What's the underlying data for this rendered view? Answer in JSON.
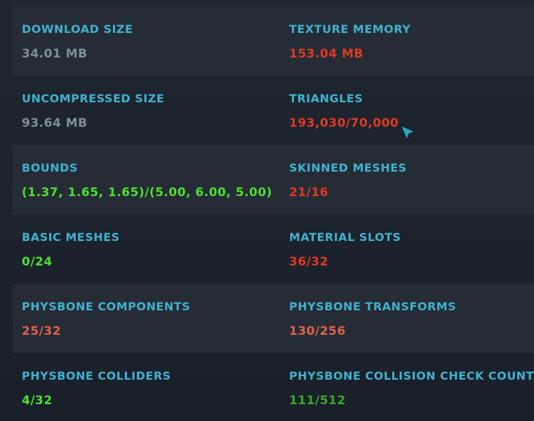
{
  "colors": {
    "label": "#3fb2cf",
    "neutral": "#7d8f99",
    "bad": "#df3a22",
    "warn": "#e0614a",
    "good": "#4ede2e",
    "good_dim": "#3aa82a"
  },
  "stats": [
    {
      "label": "DOWNLOAD SIZE",
      "value": "34.01 MB",
      "status": "neutral"
    },
    {
      "label": "TEXTURE MEMORY",
      "value": "153.04 MB",
      "status": "bad"
    },
    {
      "label": "UNCOMPRESSED SIZE",
      "value": "93.64 MB",
      "status": "neutral"
    },
    {
      "label": "TRIANGLES",
      "value": "193,030/70,000",
      "status": "bad"
    },
    {
      "label": "BOUNDS",
      "value": "(1.37, 1.65, 1.65)/(5.00, 6.00, 5.00)",
      "status": "good"
    },
    {
      "label": "SKINNED MESHES",
      "value": "21/16",
      "status": "bad"
    },
    {
      "label": "BASIC MESHES",
      "value": "0/24",
      "status": "good"
    },
    {
      "label": "MATERIAL SLOTS",
      "value": "36/32",
      "status": "bad"
    },
    {
      "label": "PHYSBONE COMPONENTS",
      "value": "25/32",
      "status": "warn"
    },
    {
      "label": "PHYSBONE TRANSFORMS",
      "value": "130/256",
      "status": "warn"
    },
    {
      "label": "PHYSBONE COLLIDERS",
      "value": "4/32",
      "status": "good"
    },
    {
      "label": "PHYSBONE COLLISION CHECK COUNT",
      "value": "111/512",
      "status": "good_dim"
    }
  ],
  "cursor": {
    "icon": "mouse-pointer-icon",
    "color": "#2aa8cc"
  }
}
